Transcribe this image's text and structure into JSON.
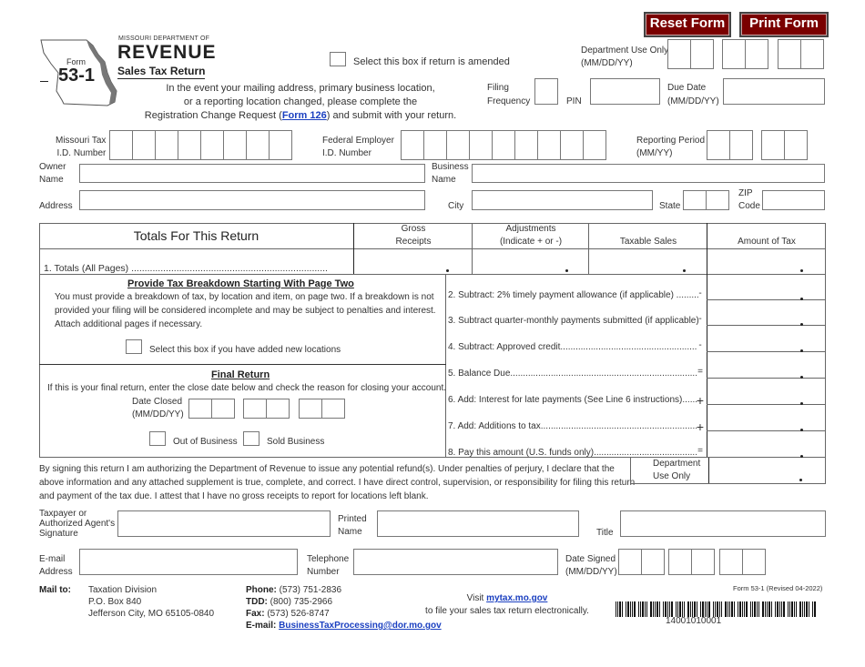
{
  "buttons": {
    "reset": "Reset Form",
    "print": "Print Form"
  },
  "header": {
    "agency_line": "MISSOURI DEPARTMENT OF",
    "agency_logo": "REVENUE",
    "form_label": "Form",
    "form_number": "53-1",
    "form_title": "Sales Tax Return",
    "amended_label": "Select this box if return is amended",
    "notice_line1": "In the event your mailing address, primary business location,",
    "notice_line2": "or a reporting location changed, please complete the",
    "notice_pre": "Registration Change Request (",
    "notice_link": "Form 126",
    "notice_post": ") and submit with your return.",
    "dept_use_label1": "Department Use Only",
    "dept_use_label2": "(MM/DD/YY)",
    "filing_label1": "Filing",
    "filing_label2": "Frequency",
    "pin_label": "PIN",
    "due_label1": "Due Date",
    "due_label2": "(MM/DD/YY)"
  },
  "ids": {
    "mo_tax_label1": "Missouri Tax",
    "mo_tax_label2": "I.D. Number",
    "fein_label1": "Federal Employer",
    "fein_label2": "I.D. Number",
    "period_label1": "Reporting Period",
    "period_label2": "(MM/YY)",
    "owner_label1": "Owner",
    "owner_label2": "Name",
    "business_label1": "Business",
    "business_label2": "Name",
    "address_label": "Address",
    "city_label": "City",
    "state_label": "State",
    "zip_label1": "ZIP",
    "zip_label2": "Code"
  },
  "totals": {
    "title": "Totals For This Return",
    "col_gross1": "Gross",
    "col_gross2": "Receipts",
    "col_adj1": "Adjustments",
    "col_adj2": "(Indicate + or -)",
    "col_taxable": "Taxable Sales",
    "col_amount": "Amount of Tax",
    "line1": "1.  Totals (All Pages) ..........................................................................",
    "lines": [
      {
        "label": "2. Subtract: 2% timely payment allowance (if applicable) .........",
        "sign": "-"
      },
      {
        "label": "3. Subtract quarter-monthly payments submitted (if applicable)",
        "sign": "-"
      },
      {
        "label": "4. Subtract: Approved credit......................................................",
        "sign": "-"
      },
      {
        "label": "5. Balance Due..........................................................................",
        "sign": "="
      },
      {
        "label": "6. Add: Interest for late payments (See Line 6 instructions)......",
        "sign": "+"
      },
      {
        "label": "7. Add: Additions to tax..............................................................",
        "sign": "+"
      },
      {
        "label": "8. Pay this amount (U.S. funds only).........................................",
        "sign": "="
      }
    ],
    "dept_use1": "Department",
    "dept_use2": "Use Only"
  },
  "breakdown": {
    "title": "Provide Tax Breakdown Starting With Page Two",
    "text1": "You must provide a breakdown of tax, by location and item, on page two.  If a breakdown is not",
    "text2": "provided your filing will be considered incomplete and may be subject to penalties and interest.",
    "text3": "Attach additional pages if necessary.",
    "new_locations_label": "Select this box if you have added new locations"
  },
  "final_return": {
    "title": "Final Return",
    "text": "If this is your final return, enter the close date below and check the reason for closing your account.",
    "date_label1": "Date Closed",
    "date_label2": "(MM/DD/YY)",
    "out_of_business": "Out of Business",
    "sold_business": "Sold Business"
  },
  "declaration": {
    "line1": "By signing this return I am authorizing the Department of Revenue to issue any potential refund(s).  Under penalties of perjury, I declare that the",
    "line2": "above information and any attached supplement is true, complete, and correct.  I have direct control, supervision, or responsibility for filing this return",
    "line3": " and payment of the tax due.  I attest that I have no gross receipts to report for locations left blank."
  },
  "signature": {
    "sig_label1": "Taxpayer or",
    "sig_label2": "Authorized Agent's",
    "sig_label3": "Signature",
    "printed1": "Printed",
    "printed2": "Name",
    "title_label": "Title",
    "email1": "E-mail",
    "email2": "Address",
    "phone1": "Telephone",
    "phone2": "Number",
    "date1": "Date Signed",
    "date2": "(MM/DD/YY)"
  },
  "footer": {
    "mail_to": "Mail to:",
    "addr1": "Taxation Division",
    "addr2": "P.O. Box 840",
    "addr3": "Jefferson City, MO 65105-0840",
    "phone_label": "Phone:",
    "phone": " (573) 751-2836",
    "tdd_label": "TDD:",
    "tdd": " (800) 735-2966",
    "fax_label": "Fax:",
    "fax": " (573) 526-8747",
    "email_label": "E-mail: ",
    "email": "BusinessTaxProcessing@dor.mo.gov",
    "visit_pre": "Visit ",
    "visit_link": "mytax.mo.gov",
    "visit_line2": "to file your sales tax return electronically.",
    "revision": "Form 53-1 (Revised 04-2022)",
    "barcode_number": "14001010001"
  }
}
